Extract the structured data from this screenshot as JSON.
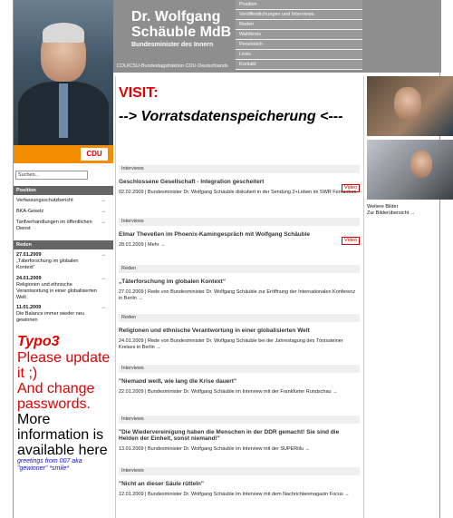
{
  "header": {
    "title_line1": "Dr. Wolfgang",
    "title_line2": "Schäuble MdB",
    "subtitle": "Bundesminister des Innern",
    "top_links": "CDU/CSU-Bundestagsfraktion  CDU-Deutschlands",
    "cdu_logo": "CDU"
  },
  "mainnav": [
    "Position",
    "Veröffentlichungen und Interviews",
    "Reden",
    "Wahlkreis",
    "Persönlich",
    "Links",
    "Kontakt"
  ],
  "search": {
    "placeholder": "Suchen..."
  },
  "sidebar": {
    "position_head": "Position",
    "position_items": [
      "Verfassungsschutzbericht",
      "BKA-Gesetz",
      "Tarifverhandlungen im öffentlichen Dienst"
    ],
    "reden_head": "Reden",
    "reden_items": [
      {
        "date": "27.01.2009",
        "text": "„Täterforschung im globalen Kontext“"
      },
      {
        "date": "24.01.2009",
        "text": "Religionen und ethnische Verantwortung in einer globalisierten Welt"
      },
      {
        "date": "11.01.2009",
        "text": "Die Balance immer wieder neu gewinnen"
      }
    ]
  },
  "hack": {
    "typo3": "Typo3",
    "line1": "Please update it ;)",
    "line2": "And change passwords.",
    "line3": "More information is available here",
    "line4": "greetings from 007 aka \"gewinner\" *smile*"
  },
  "visit": "VISIT:",
  "vds": "--> Vorratsdatenspeicherung <---",
  "news": [
    {
      "cat": "Interviews",
      "head": "Geschlossene Gesellschaft - Integration gescheitert",
      "video": "Video",
      "txt": "02.02.2009  |  Bundesminister Dr. Wolfgang Schäuble diskutiert in der Sendung 2+Leben im SWR Fernsehen"
    },
    {
      "cat": "Interviews",
      "head": "Elmar Theveßen im Phoenix-Kamingespräch mit Wolfgang Schäuble",
      "video": "Video",
      "txt": "28.01.2009  |  Mehr  →"
    },
    {
      "cat": "Reden",
      "head": "„Täterforschung im globalen Kontext“",
      "txt": "27.01.2009  |  Rede von Bundesminister Dr. Wolfgang Schäuble zur Eröffnung der Internationalen Konferenz in Berlin  →"
    },
    {
      "cat": "Reden",
      "head": "Religionen und ethnische Verantwortung in einer globalisierten Welt",
      "txt": "24.01.2009  |  Rede von Bundesminister Dr. Wolfgang Schäuble bei der Jahrestagung des Tönissteiner Kreises in Berlin  →"
    },
    {
      "cat": "Interviews",
      "head": "\"Niemand weiß, wie lang die Krise dauert\"",
      "txt": "22.01.2009  |  Bundesminister Dr. Wolfgang Schäuble im Interview mit der Frankfurter Rundschau  →"
    },
    {
      "cat": "Interviews",
      "head": "\"Die Wiedervereinigung haben die Menschen in der DDR gemacht! Sie sind die Helden der Einheit, sonst niemand!\"",
      "txt": "13.01.2009  |  Bundesminister Dr. Wolfgang Schäuble im Interview mit der SUPERillu  →"
    },
    {
      "cat": "Interviews",
      "head": "\"Nicht an dieser Säule rütteln\"",
      "txt": "12.01.2009  |  Bundesminister Dr. Wolfgang Schäuble im Interview mit dem Nachrichtenmagazin Focus  →"
    }
  ],
  "right": {
    "caption1": "Weitere Bilder",
    "caption2": "Zur Bilderübersicht  →"
  }
}
